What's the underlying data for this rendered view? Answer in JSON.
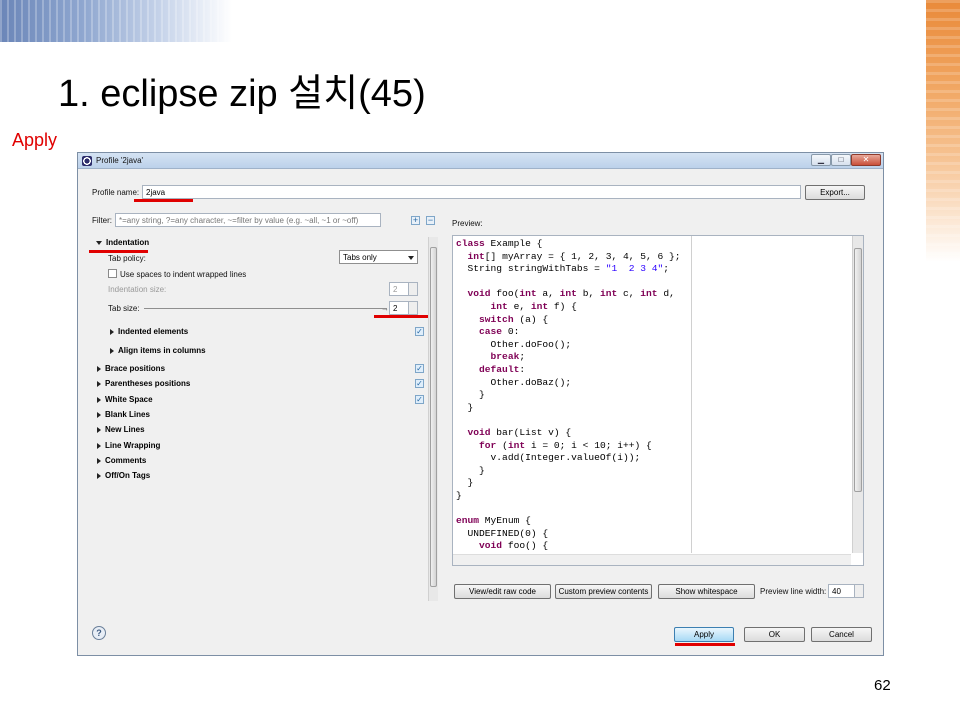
{
  "slide": {
    "title": "1. eclipse zip 설치(45)",
    "note": "Apply",
    "page_number": "62"
  },
  "dialog": {
    "title": "Profile '2java'",
    "profile_name_label": "Profile name:",
    "profile_name_value": "2java",
    "export_button": "Export...",
    "filter_label": "Filter:",
    "filter_placeholder": "*=any string, ?=any character, ~=filter by value (e.g. ~all, ~1 or ~off)",
    "preview_label": "Preview:",
    "indentation": {
      "section": "Indentation",
      "tab_policy_label": "Tab policy:",
      "tab_policy_value": "Tabs only",
      "use_spaces_label": "Use spaces to indent wrapped lines",
      "indentation_size_label": "Indentation size:",
      "indentation_size_value": "2",
      "tab_size_label": "Tab size:",
      "tab_size_value": "2",
      "indented_elements": "Indented elements",
      "align_items": "Align items in columns"
    },
    "sections": [
      "Brace positions",
      "Parentheses positions",
      "White Space",
      "Blank Lines",
      "New Lines",
      "Line Wrapping",
      "Comments",
      "Off/On Tags"
    ],
    "buttons": {
      "view_edit_raw": "View/edit raw code",
      "custom_preview": "Custom preview contents",
      "show_whitespace": "Show whitespace",
      "preview_line_width_label": "Preview line width:",
      "preview_line_width_value": "40",
      "apply": "Apply",
      "ok": "OK",
      "cancel": "Cancel"
    },
    "help_icon": "help-icon"
  },
  "code_lines": [
    [
      {
        "t": "class",
        "k": 1
      },
      {
        "t": " Example {"
      }
    ],
    [
      {
        "t": "  "
      },
      {
        "t": "int",
        "k": 1
      },
      {
        "t": "[] myArray = { 1, 2, 3, 4, 5, 6 };"
      }
    ],
    [
      {
        "t": "  String stringWithTabs = "
      },
      {
        "t": "\"1  2 3 4\"",
        "s": 1
      },
      {
        "t": ";"
      }
    ],
    [
      {
        "t": ""
      }
    ],
    [
      {
        "t": "  "
      },
      {
        "t": "void",
        "k": 1
      },
      {
        "t": " foo("
      },
      {
        "t": "int",
        "k": 1
      },
      {
        "t": " a, "
      },
      {
        "t": "int",
        "k": 1
      },
      {
        "t": " b, "
      },
      {
        "t": "int",
        "k": 1
      },
      {
        "t": " c, "
      },
      {
        "t": "int",
        "k": 1
      },
      {
        "t": " d,"
      }
    ],
    [
      {
        "t": "      "
      },
      {
        "t": "int",
        "k": 1
      },
      {
        "t": " e, "
      },
      {
        "t": "int",
        "k": 1
      },
      {
        "t": " f) {"
      }
    ],
    [
      {
        "t": "    "
      },
      {
        "t": "switch",
        "k": 1
      },
      {
        "t": " (a) {"
      }
    ],
    [
      {
        "t": "    "
      },
      {
        "t": "case",
        "k": 1
      },
      {
        "t": " 0:"
      }
    ],
    [
      {
        "t": "      Other.doFoo();"
      }
    ],
    [
      {
        "t": "      "
      },
      {
        "t": "break",
        "k": 1
      },
      {
        "t": ";"
      }
    ],
    [
      {
        "t": "    "
      },
      {
        "t": "default",
        "k": 1
      },
      {
        "t": ":"
      }
    ],
    [
      {
        "t": "      Other.doBaz();"
      }
    ],
    [
      {
        "t": "    }"
      }
    ],
    [
      {
        "t": "  }"
      }
    ],
    [
      {
        "t": ""
      }
    ],
    [
      {
        "t": "  "
      },
      {
        "t": "void",
        "k": 1
      },
      {
        "t": " bar(List v) {"
      }
    ],
    [
      {
        "t": "    "
      },
      {
        "t": "for",
        "k": 1
      },
      {
        "t": " ("
      },
      {
        "t": "int",
        "k": 1
      },
      {
        "t": " i = 0; i < 10; i++) {"
      }
    ],
    [
      {
        "t": "      v.add(Integer.valueOf(i));"
      }
    ],
    [
      {
        "t": "    }"
      }
    ],
    [
      {
        "t": "  }"
      }
    ],
    [
      {
        "t": "}"
      }
    ],
    [
      {
        "t": ""
      }
    ],
    [
      {
        "t": "enum",
        "k": 1
      },
      {
        "t": " MyEnum {"
      }
    ],
    [
      {
        "t": "  UNDEFINED(0) {"
      }
    ],
    [
      {
        "t": "    "
      },
      {
        "t": "void",
        "k": 1
      },
      {
        "t": " foo() {"
      }
    ],
    [
      {
        "t": "    }"
      }
    ]
  ]
}
